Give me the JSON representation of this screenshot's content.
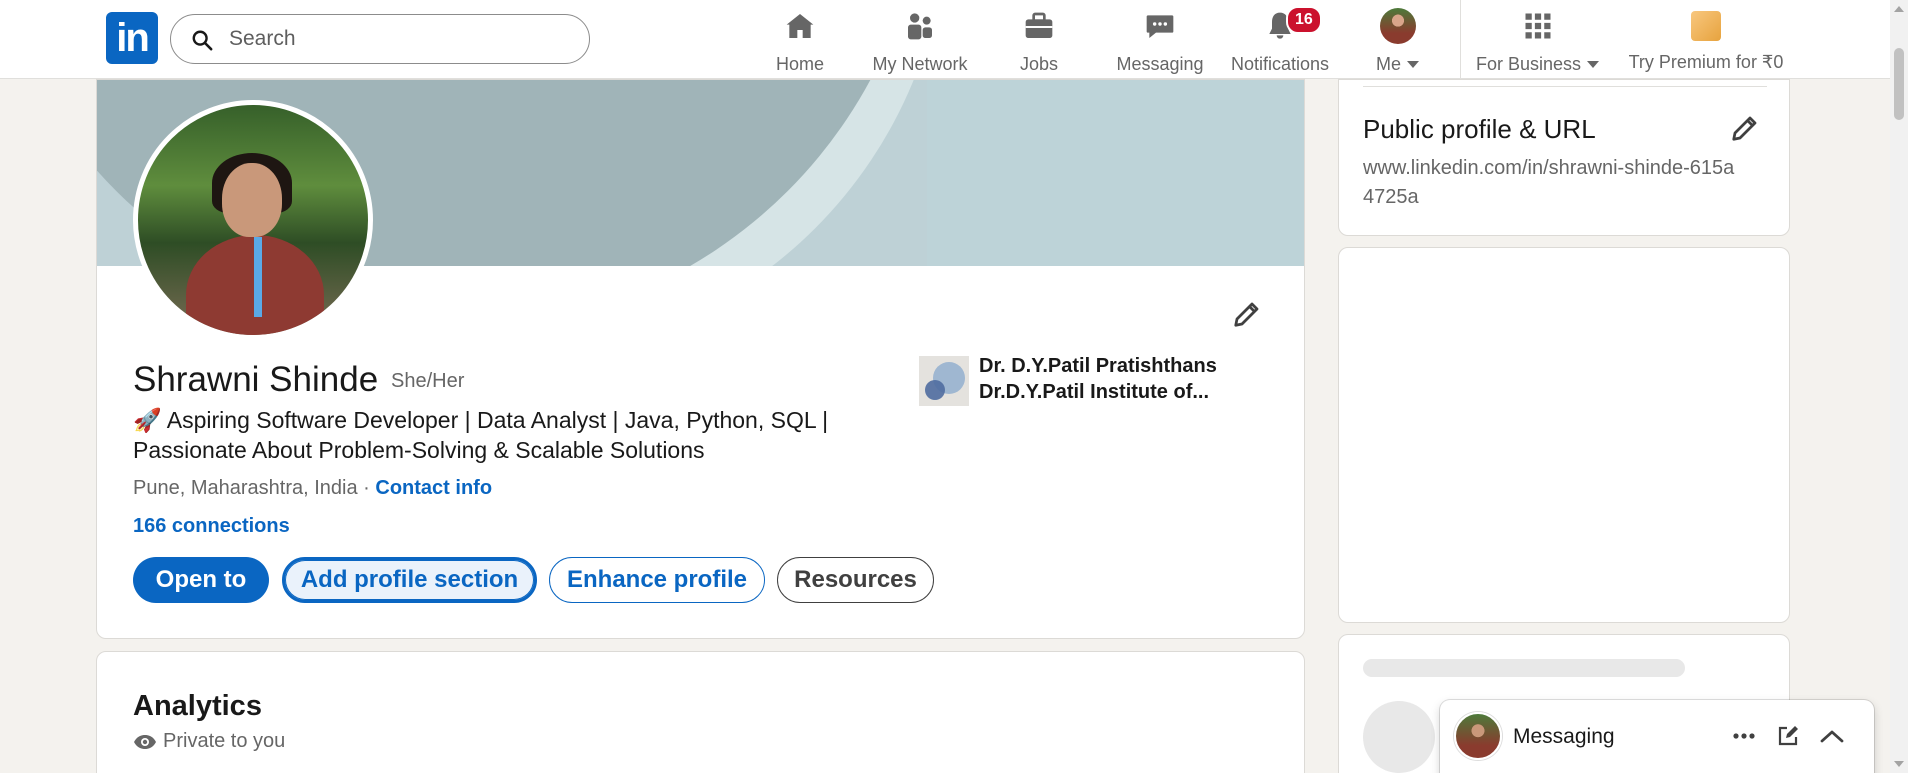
{
  "nav": {
    "search_placeholder": "Search",
    "items": [
      {
        "label": "Home",
        "icon": "home-icon"
      },
      {
        "label": "My Network",
        "icon": "network-icon"
      },
      {
        "label": "Jobs",
        "icon": "briefcase-icon"
      },
      {
        "label": "Messaging",
        "icon": "chat-icon"
      },
      {
        "label": "Notifications",
        "icon": "bell-icon",
        "badge": "16"
      },
      {
        "label": "Me",
        "icon": "avatar"
      },
      {
        "label": "For Business",
        "icon": "grid-icon"
      },
      {
        "label": "Try Premium for ₹0",
        "icon": "premium-icon"
      }
    ]
  },
  "profile": {
    "name": "Shrawni Shinde",
    "pronoun": "She/Her",
    "headline_emoji": "🚀",
    "headline": "Aspiring Software Developer | Data Analyst | Java, Python, SQL | Passionate About Problem-Solving & Scalable Solutions",
    "location": "Pune, Maharashtra, India",
    "separator": "·",
    "contact_info": "Contact info",
    "connections": "166 connections",
    "education_line1": "Dr. D.Y.Patil Pratishthans",
    "education_line2": "Dr.D.Y.Patil Institute of...",
    "buttons": {
      "open_to": "Open to",
      "add_section": "Add profile section",
      "enhance": "Enhance profile",
      "resources": "Resources"
    }
  },
  "analytics": {
    "title": "Analytics",
    "privacy": "Private to you"
  },
  "public_profile": {
    "title": "Public profile & URL",
    "url": "www.linkedin.com/in/shrawni-shinde-615a4725a"
  },
  "messaging": {
    "title": "Messaging"
  },
  "colors": {
    "brand": "#0a66c2",
    "badge": "#cb112d",
    "background": "#f4f2ee"
  }
}
